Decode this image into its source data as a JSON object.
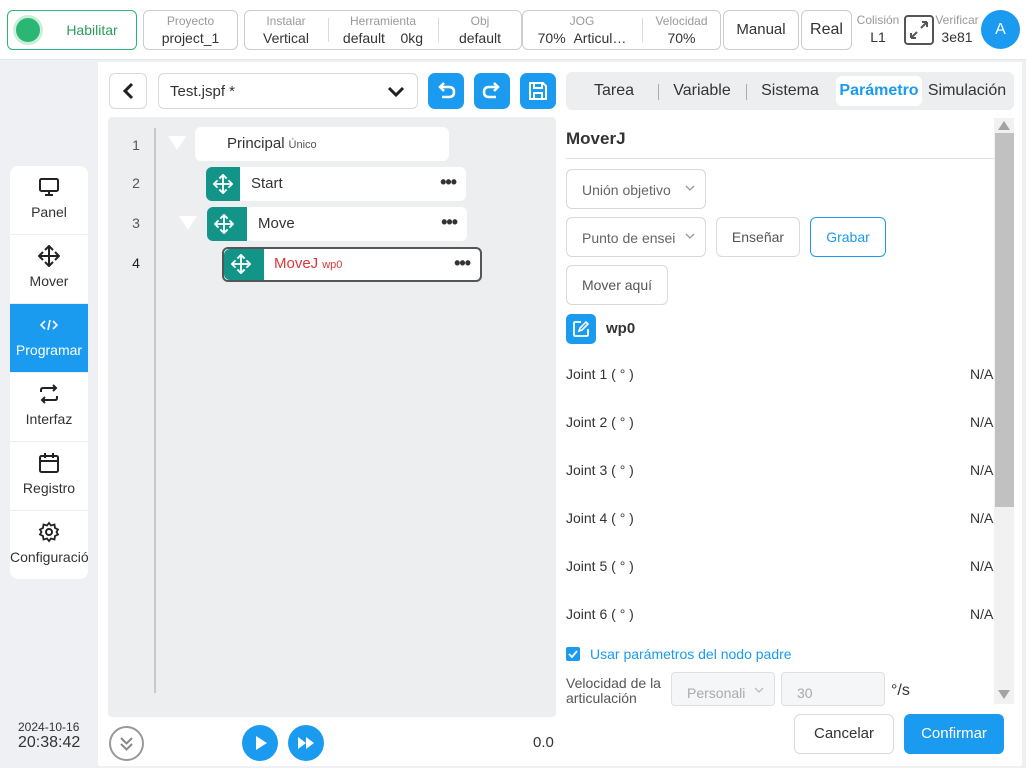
{
  "topbar": {
    "enable_label": "Habilitar",
    "project": {
      "caption": "Proyecto",
      "value": "project_1"
    },
    "install": {
      "caption": "Instalar",
      "value": "Vertical"
    },
    "tool": {
      "caption": "Herramienta",
      "value": "default",
      "value2": "0kg"
    },
    "obj": {
      "caption": "Obj",
      "value": "default"
    },
    "jog": {
      "caption": "JOG",
      "value": "70%",
      "value2": "Articul…"
    },
    "speed": {
      "caption": "Velocidad",
      "value": "70%"
    },
    "mode_label": "Manual",
    "real_label": "Real",
    "collision": {
      "caption": "Colisión",
      "value": "L1"
    },
    "verify": {
      "caption": "Verificar",
      "value": "3e81"
    },
    "avatar_letter": "A"
  },
  "nav": {
    "items": [
      {
        "label": "Panel",
        "icon": "monitor-icon"
      },
      {
        "label": "Mover",
        "icon": "move-arrows-icon"
      },
      {
        "label": "Programar",
        "icon": "code-icon"
      },
      {
        "label": "Interfaz",
        "icon": "swap-arrows-icon"
      },
      {
        "label": "Registro",
        "icon": "calendar-icon"
      },
      {
        "label": "Configuración",
        "icon": "gear-icon"
      }
    ],
    "active": "Programar"
  },
  "clock": {
    "date": "2024-10-16",
    "time": "20:38:42"
  },
  "editor": {
    "file_name": "Test.jspf *",
    "tree": [
      {
        "line": "1",
        "label": "Principal",
        "sub": "Único"
      },
      {
        "line": "2",
        "label": "Start"
      },
      {
        "line": "3",
        "label": "Move"
      },
      {
        "line": "4",
        "label": "MoveJ",
        "sub": "wp0"
      }
    ],
    "speed_value": "0.0"
  },
  "tabs": [
    "Tarea",
    "Variable",
    "Sistema",
    "Parámetro",
    "Simulación"
  ],
  "active_tab": "Parámetro",
  "panel": {
    "title": "MoverJ",
    "target_select": "Unión objetivo",
    "teach_point_select": "Punto de ensei",
    "teach_button": "Enseñar",
    "record_button": "Grabar",
    "move_here_button": "Mover aquí",
    "waypoint_name": "wp0",
    "joints": [
      {
        "label": "Joint 1 ( ° )",
        "value": "N/A"
      },
      {
        "label": "Joint 2 ( ° )",
        "value": "N/A"
      },
      {
        "label": "Joint 3 ( ° )",
        "value": "N/A"
      },
      {
        "label": "Joint 4 ( ° )",
        "value": "N/A"
      },
      {
        "label": "Joint 5 ( ° )",
        "value": "N/A"
      },
      {
        "label": "Joint 6 ( ° )",
        "value": "N/A"
      }
    ],
    "use_parent_label": "Usar parámetros del nodo padre",
    "use_parent_checked": true,
    "joint_velocity_label": "Velocidad de la articulación",
    "velocity_mode": "Personali",
    "velocity_value": "30",
    "velocity_unit": "°/s",
    "cancel_label": "Cancelar",
    "confirm_label": "Confirmar"
  },
  "colors": {
    "accent": "#1a9bef",
    "teal": "#139489",
    "green": "#2bb673",
    "error_red": "#d9383a"
  }
}
